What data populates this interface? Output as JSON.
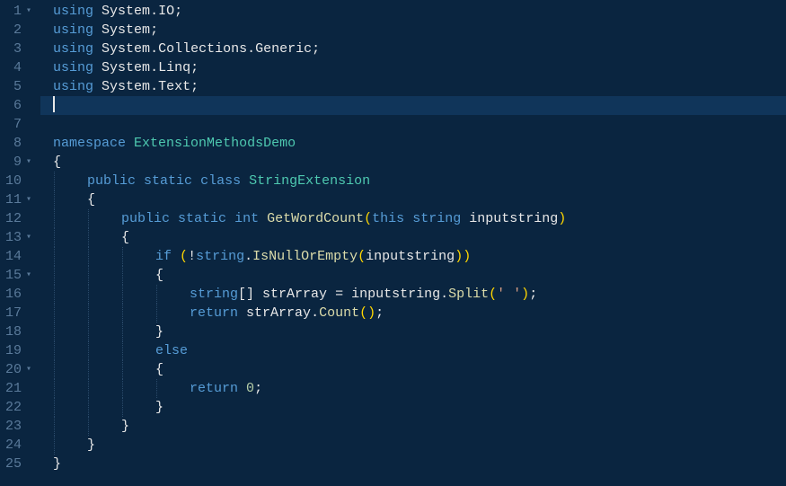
{
  "editor": {
    "current_line": 6,
    "gutter": [
      {
        "num": "1",
        "fold": true
      },
      {
        "num": "2",
        "fold": false
      },
      {
        "num": "3",
        "fold": false
      },
      {
        "num": "4",
        "fold": false
      },
      {
        "num": "5",
        "fold": false
      },
      {
        "num": "6",
        "fold": false
      },
      {
        "num": "7",
        "fold": false
      },
      {
        "num": "8",
        "fold": false
      },
      {
        "num": "9",
        "fold": true
      },
      {
        "num": "10",
        "fold": false
      },
      {
        "num": "11",
        "fold": true
      },
      {
        "num": "12",
        "fold": false
      },
      {
        "num": "13",
        "fold": true
      },
      {
        "num": "14",
        "fold": false
      },
      {
        "num": "15",
        "fold": true
      },
      {
        "num": "16",
        "fold": false
      },
      {
        "num": "17",
        "fold": false
      },
      {
        "num": "18",
        "fold": false
      },
      {
        "num": "19",
        "fold": false
      },
      {
        "num": "20",
        "fold": true
      },
      {
        "num": "21",
        "fold": false
      },
      {
        "num": "22",
        "fold": false
      },
      {
        "num": "23",
        "fold": false
      },
      {
        "num": "24",
        "fold": false
      },
      {
        "num": "25",
        "fold": false
      }
    ],
    "lines": [
      {
        "indent": 0,
        "tokens": [
          [
            "kw",
            "using"
          ],
          [
            "punct",
            " "
          ],
          [
            "ident",
            "System"
          ],
          [
            "punct",
            "."
          ],
          [
            "ident",
            "IO"
          ],
          [
            "punct",
            ";"
          ]
        ]
      },
      {
        "indent": 0,
        "tokens": [
          [
            "kw",
            "using"
          ],
          [
            "punct",
            " "
          ],
          [
            "ident",
            "System"
          ],
          [
            "punct",
            ";"
          ]
        ]
      },
      {
        "indent": 0,
        "tokens": [
          [
            "kw",
            "using"
          ],
          [
            "punct",
            " "
          ],
          [
            "ident",
            "System"
          ],
          [
            "punct",
            "."
          ],
          [
            "ident",
            "Collections"
          ],
          [
            "punct",
            "."
          ],
          [
            "ident",
            "Generic"
          ],
          [
            "punct",
            ";"
          ]
        ]
      },
      {
        "indent": 0,
        "tokens": [
          [
            "kw",
            "using"
          ],
          [
            "punct",
            " "
          ],
          [
            "ident",
            "System"
          ],
          [
            "punct",
            "."
          ],
          [
            "ident",
            "Linq"
          ],
          [
            "punct",
            ";"
          ]
        ]
      },
      {
        "indent": 0,
        "tokens": [
          [
            "kw",
            "using"
          ],
          [
            "punct",
            " "
          ],
          [
            "ident",
            "System"
          ],
          [
            "punct",
            "."
          ],
          [
            "ident",
            "Text"
          ],
          [
            "punct",
            ";"
          ]
        ]
      },
      {
        "indent": 0,
        "cursor": true,
        "tokens": []
      },
      {
        "indent": 0,
        "tokens": []
      },
      {
        "indent": 0,
        "tokens": [
          [
            "kw",
            "namespace"
          ],
          [
            "punct",
            " "
          ],
          [
            "type",
            "ExtensionMethodsDemo"
          ]
        ]
      },
      {
        "indent": 0,
        "tokens": [
          [
            "punct",
            "{"
          ]
        ]
      },
      {
        "indent": 1,
        "tokens": [
          [
            "kw",
            "public"
          ],
          [
            "punct",
            " "
          ],
          [
            "kw",
            "static"
          ],
          [
            "punct",
            " "
          ],
          [
            "kw",
            "class"
          ],
          [
            "punct",
            " "
          ],
          [
            "type",
            "StringExtension"
          ]
        ]
      },
      {
        "indent": 1,
        "tokens": [
          [
            "punct",
            "{"
          ]
        ]
      },
      {
        "indent": 2,
        "tokens": [
          [
            "kw",
            "public"
          ],
          [
            "punct",
            " "
          ],
          [
            "kw",
            "static"
          ],
          [
            "punct",
            " "
          ],
          [
            "kw",
            "int"
          ],
          [
            "punct",
            " "
          ],
          [
            "method",
            "GetWordCount"
          ],
          [
            "paren",
            "("
          ],
          [
            "kw",
            "this"
          ],
          [
            "punct",
            " "
          ],
          [
            "kw",
            "string"
          ],
          [
            "punct",
            " "
          ],
          [
            "ident",
            "inputstring"
          ],
          [
            "paren",
            ")"
          ]
        ]
      },
      {
        "indent": 2,
        "tokens": [
          [
            "punct",
            "{"
          ]
        ]
      },
      {
        "indent": 3,
        "tokens": [
          [
            "kw",
            "if"
          ],
          [
            "punct",
            " "
          ],
          [
            "paren",
            "("
          ],
          [
            "punct",
            "!"
          ],
          [
            "kw",
            "string"
          ],
          [
            "punct",
            "."
          ],
          [
            "method",
            "IsNullOrEmpty"
          ],
          [
            "paren",
            "("
          ],
          [
            "ident",
            "inputstring"
          ],
          [
            "paren",
            "))"
          ]
        ]
      },
      {
        "indent": 3,
        "tokens": [
          [
            "punct",
            "{"
          ]
        ]
      },
      {
        "indent": 4,
        "tokens": [
          [
            "kw",
            "string"
          ],
          [
            "punct",
            "[] "
          ],
          [
            "ident",
            "strArray"
          ],
          [
            "punct",
            " = "
          ],
          [
            "ident",
            "inputstring"
          ],
          [
            "punct",
            "."
          ],
          [
            "method",
            "Split"
          ],
          [
            "paren",
            "("
          ],
          [
            "str",
            "' '"
          ],
          [
            "paren",
            ")"
          ],
          [
            "punct",
            ";"
          ]
        ]
      },
      {
        "indent": 4,
        "tokens": [
          [
            "kw",
            "return"
          ],
          [
            "punct",
            " "
          ],
          [
            "ident",
            "strArray"
          ],
          [
            "punct",
            "."
          ],
          [
            "method",
            "Count"
          ],
          [
            "paren",
            "()"
          ],
          [
            "punct",
            ";"
          ]
        ]
      },
      {
        "indent": 3,
        "tokens": [
          [
            "punct",
            "}"
          ]
        ]
      },
      {
        "indent": 3,
        "tokens": [
          [
            "kw",
            "else"
          ]
        ]
      },
      {
        "indent": 3,
        "tokens": [
          [
            "punct",
            "{"
          ]
        ]
      },
      {
        "indent": 4,
        "tokens": [
          [
            "kw",
            "return"
          ],
          [
            "punct",
            " "
          ],
          [
            "num",
            "0"
          ],
          [
            "punct",
            ";"
          ]
        ]
      },
      {
        "indent": 3,
        "tokens": [
          [
            "punct",
            "}"
          ]
        ]
      },
      {
        "indent": 2,
        "tokens": [
          [
            "punct",
            "}"
          ]
        ]
      },
      {
        "indent": 1,
        "tokens": [
          [
            "punct",
            "}"
          ]
        ]
      },
      {
        "indent": 0,
        "tokens": [
          [
            "punct",
            "}"
          ]
        ]
      }
    ]
  }
}
